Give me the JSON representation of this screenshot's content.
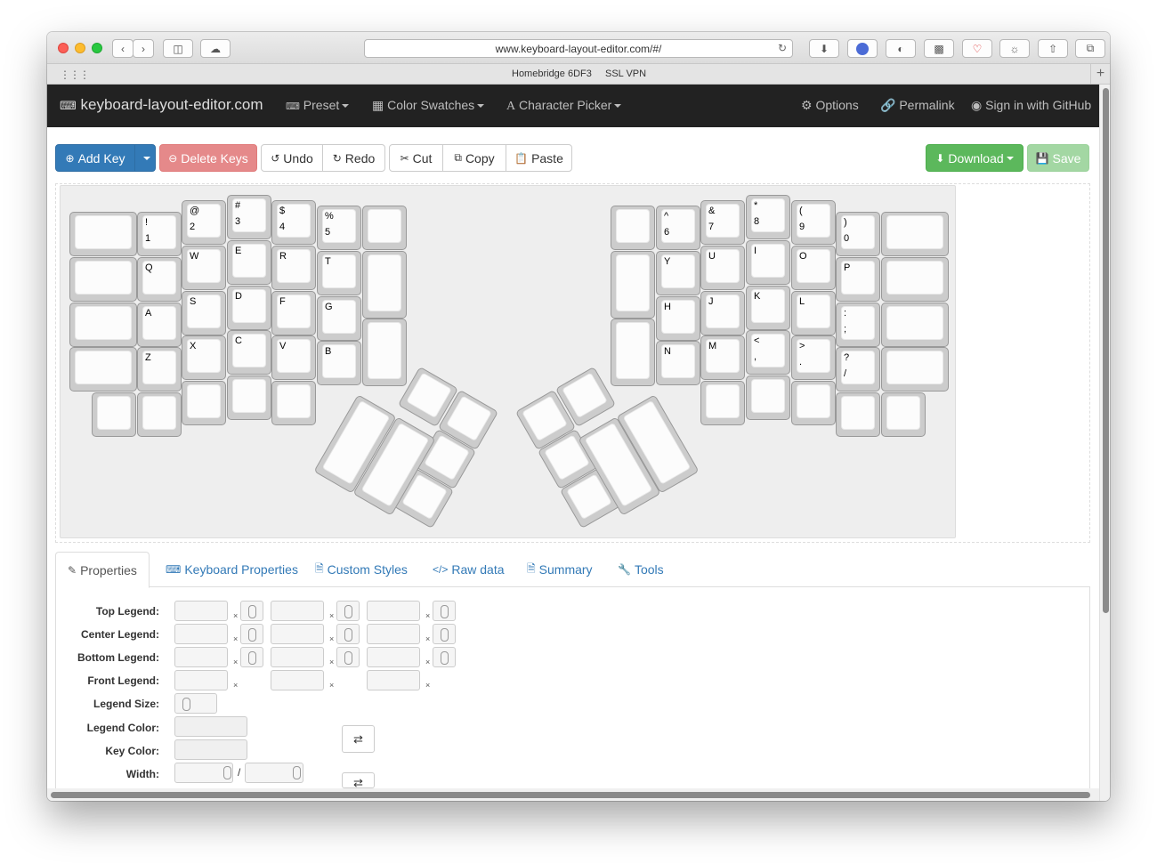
{
  "browser": {
    "url": "www.keyboard-layout-editor.com/#/",
    "bookmarks": [
      "Homebridge 6DF3",
      "SSL VPN"
    ],
    "new_tab_label": "+"
  },
  "navbar": {
    "brand": "keyboard-layout-editor.com",
    "preset": "Preset",
    "swatches": "Color Swatches",
    "picker": "Character Picker",
    "options": "Options",
    "permalink": "Permalink",
    "signin": "Sign in with GitHub"
  },
  "toolbar": {
    "add_key": "Add Key",
    "delete_keys": "Delete Keys",
    "undo": "Undo",
    "redo": "Redo",
    "cut": "Cut",
    "copy": "Copy",
    "paste": "Paste",
    "download": "Download",
    "save": "Save"
  },
  "keys": [
    {
      "top": "",
      "bottom": ""
    },
    {
      "top": "!",
      "bottom": "1"
    },
    {
      "top": "@",
      "bottom": "2"
    },
    {
      "top": "#",
      "bottom": "3"
    },
    {
      "top": "$",
      "bottom": "4"
    },
    {
      "top": "%",
      "bottom": "5"
    },
    {
      "top": "Q",
      "bottom": ""
    },
    {
      "top": "W",
      "bottom": ""
    },
    {
      "top": "E",
      "bottom": ""
    },
    {
      "top": "R",
      "bottom": ""
    },
    {
      "top": "T",
      "bottom": ""
    },
    {
      "top": "A",
      "bottom": ""
    },
    {
      "top": "S",
      "bottom": ""
    },
    {
      "top": "D",
      "bottom": ""
    },
    {
      "top": "F",
      "bottom": ""
    },
    {
      "top": "G",
      "bottom": ""
    },
    {
      "top": "Z",
      "bottom": ""
    },
    {
      "top": "X",
      "bottom": ""
    },
    {
      "top": "C",
      "bottom": ""
    },
    {
      "top": "V",
      "bottom": ""
    },
    {
      "top": "B",
      "bottom": ""
    },
    {
      "top": "^",
      "bottom": "6"
    },
    {
      "top": "&",
      "bottom": "7"
    },
    {
      "top": "*",
      "bottom": "8"
    },
    {
      "top": "(",
      "bottom": "9"
    },
    {
      "top": ")",
      "bottom": "0"
    },
    {
      "top": "Y",
      "bottom": ""
    },
    {
      "top": "U",
      "bottom": ""
    },
    {
      "top": "I",
      "bottom": ""
    },
    {
      "top": "O",
      "bottom": ""
    },
    {
      "top": "P",
      "bottom": ""
    },
    {
      "top": "H",
      "bottom": ""
    },
    {
      "top": "J",
      "bottom": ""
    },
    {
      "top": "K",
      "bottom": ""
    },
    {
      "top": "L",
      "bottom": ""
    },
    {
      "top": ":",
      "bottom": ";"
    },
    {
      "top": "N",
      "bottom": ""
    },
    {
      "top": "M",
      "bottom": ""
    },
    {
      "top": "<",
      "bottom": ","
    },
    {
      "top": ">",
      "bottom": "."
    },
    {
      "top": "?",
      "bottom": "/"
    }
  ],
  "tabs": [
    {
      "label": "Properties"
    },
    {
      "label": "Keyboard Properties"
    },
    {
      "label": "Custom Styles"
    },
    {
      "label": "Raw data"
    },
    {
      "label": "Summary"
    },
    {
      "label": "Tools"
    }
  ],
  "properties": {
    "top_legend": "Top Legend:",
    "center_legend": "Center Legend:",
    "bottom_legend": "Bottom Legend:",
    "front_legend": "Front Legend:",
    "legend_size": "Legend Size:",
    "legend_color": "Legend Color:",
    "key_color": "Key Color:",
    "width": "Width:",
    "clear_mark": "×",
    "width_separator": "/"
  }
}
